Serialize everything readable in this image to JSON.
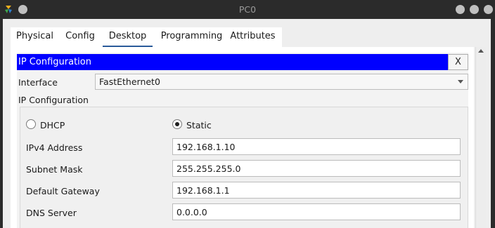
{
  "window": {
    "title": "PC0"
  },
  "tabs": [
    {
      "label": "Physical"
    },
    {
      "label": "Config"
    },
    {
      "label": "Desktop",
      "active": true
    },
    {
      "label": "Programming"
    },
    {
      "label": "Attributes"
    }
  ],
  "panel": {
    "header_title": "IP Configuration",
    "close_label": "X",
    "interface_label": "Interface",
    "interface_value": "FastEthernet0",
    "section_label": "IP Configuration"
  },
  "ip_config": {
    "dhcp_label": "DHCP",
    "static_label": "Static",
    "selected_mode": "Static",
    "ipv4_label": "IPv4 Address",
    "ipv4_value": "192.168.1.10",
    "subnet_label": "Subnet Mask",
    "subnet_value": "255.255.255.0",
    "gateway_label": "Default Gateway",
    "gateway_value": "192.168.1.1",
    "dns_label": "DNS Server",
    "dns_value": "0.0.0.0"
  },
  "colors": {
    "header_blue": "#0000ff",
    "active_tab_underline": "#2a5a9a"
  }
}
